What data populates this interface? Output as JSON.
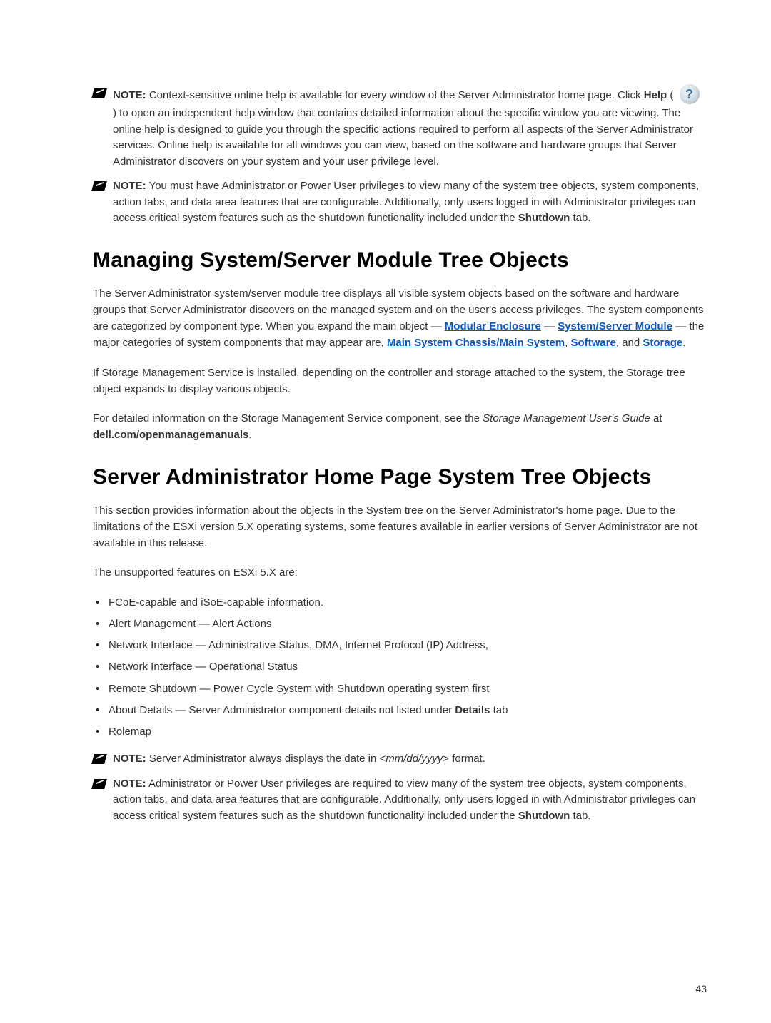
{
  "notes": {
    "note1": {
      "label": "NOTE:",
      "pre": " Context-sensitive online help is available for every window of the Server Administrator home page. Click ",
      "help_bold": "Help",
      "post_icon_text": " to open an independent help window that contains detailed information about the specific window you are viewing. The online help is designed to guide you through the specific actions required to perform all aspects of the Server Administrator services. Online help is available for all windows you can view, based on the software and hardware groups that Server Administrator discovers on your system and your user privilege level."
    },
    "note2": {
      "label": "NOTE:",
      "text": " You must have Administrator or Power User privileges to view many of the system tree objects, system components, action tabs, and data area features that are configurable. Additionally, only users logged in with Administrator privileges can access critical system features such as the shutdown functionality included under the ",
      "shutdown": "Shutdown",
      "tail": " tab."
    },
    "note3": {
      "label": "NOTE:",
      "text_pre": " Server Administrator always displays the date in <",
      "italic": "mm/dd/yyyy",
      "text_post": "> format."
    },
    "note4": {
      "label": "NOTE:",
      "text": " Administrator or Power User privileges are required to view many of the system tree objects, system components, action tabs, and data area features that are configurable. Additionally, only users logged in with Administrator privileges can access critical system features such as the shutdown functionality included under the ",
      "shutdown": "Shutdown",
      "tail": " tab."
    }
  },
  "headings": {
    "h1": "Managing System/Server Module Tree Objects",
    "h2": "Server Administrator Home Page System Tree Objects"
  },
  "paragraphs": {
    "p1_pre": "The Server Administrator system/server module tree displays all visible system objects based on the software and hardware groups that Server Administrator discovers on the managed system and on the user's access privileges. The system components are categorized by component type. When you expand the main object — ",
    "link_modular": "Modular Enclosure",
    "dash": " — ",
    "link_system_server": "System/Server Module",
    "p1_mid": " — the major categories of system components that may appear are, ",
    "link_main_system": "Main System Chassis/Main System",
    "comma1": ", ",
    "link_software": "Software",
    "and": ", and ",
    "link_storage": "Storage",
    "period": ".",
    "p2": "If Storage Management Service is installed, depending on the controller and storage attached to the system, the Storage tree object expands to display various objects.",
    "p3_pre": "For detailed information on the Storage Management Service component, see the ",
    "p3_italic": "Storage Management User's Guide",
    "p3_at": " at ",
    "p3_bold": "dell.com/openmanagemanuals",
    "p4": "This section provides information about the objects in the System tree on the Server Administrator's home page. Due to the limitations of the ESXi version 5.X operating systems, some features available in earlier versions of Server Administrator are not available in this release.",
    "p5": "The unsupported features on ESXi 5.X are:"
  },
  "bullets": [
    {
      "text": "FCoE-capable and iSoE-capable information."
    },
    {
      "text": "Alert Management — Alert Actions"
    },
    {
      "text": "Network Interface — Administrative Status, DMA, Internet Protocol (IP) Address,"
    },
    {
      "text": "Network Interface — Operational Status"
    },
    {
      "text": "Remote Shutdown — Power Cycle System with Shutdown operating system first"
    },
    {
      "text_pre": "About Details — Server Administrator component details not listed under ",
      "bold": "Details",
      "text_post": " tab"
    },
    {
      "text": "Rolemap"
    }
  ],
  "page_number": "43",
  "help_glyph": "?"
}
